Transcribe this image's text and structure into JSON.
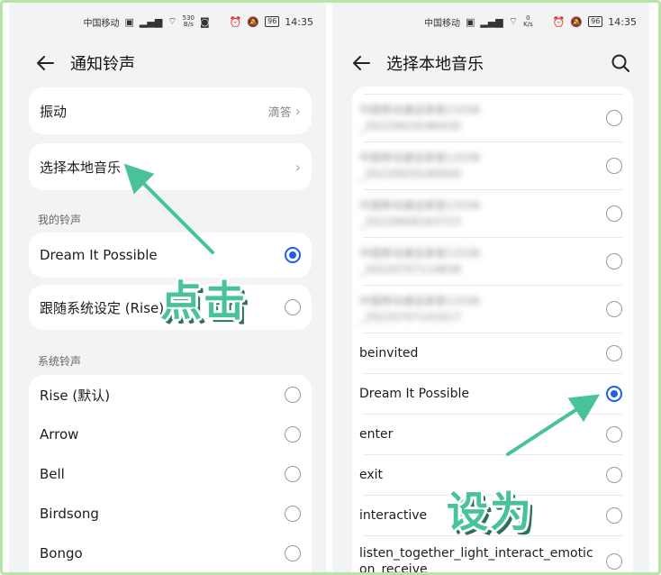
{
  "status_bar": {
    "carrier": "中国移动",
    "speed_left": "530\nB/s",
    "speed_right": "0\nK/s",
    "battery": "96",
    "time": "14:35"
  },
  "left": {
    "title": "通知铃声",
    "vibration": {
      "label": "振动",
      "value": "滴答"
    },
    "local_music": {
      "label": "选择本地音乐"
    },
    "my_ringtones_title": "我的铃声",
    "my_ringtones": [
      {
        "label": "Dream It Possible",
        "checked": true
      },
      {
        "label": "跟随系统设定 (Rise)",
        "checked": false
      }
    ],
    "system_ringtones_title": "系统铃声",
    "system_ringtones": [
      {
        "label": "Rise (默认)",
        "checked": false
      },
      {
        "label": "Arrow",
        "checked": false
      },
      {
        "label": "Bell",
        "checked": false
      },
      {
        "label": "Birdsong",
        "checked": false
      },
      {
        "label": "Bongo",
        "checked": false
      }
    ]
  },
  "right": {
    "title": "选择本地音乐",
    "blurred_items": [
      {
        "line1": "中国移动通话录音13336",
        "line2": "_20220929180430"
      },
      {
        "line1": "中国移动通话录音13336",
        "line2": "_20220929180600"
      },
      {
        "line1": "中国移动通话录音13336",
        "line2": "_20220606163723"
      },
      {
        "line1": "中国移动通话录音13336",
        "line2": "_20220707114838"
      },
      {
        "line1": "中国移动通话录音13336",
        "line2": "_20220707141617"
      }
    ],
    "items": [
      {
        "label": "beinvited",
        "checked": false
      },
      {
        "label": "Dream It Possible",
        "checked": true
      },
      {
        "label": "enter",
        "checked": false
      },
      {
        "label": "exit",
        "checked": false
      },
      {
        "label": "interactive",
        "checked": false
      }
    ],
    "long_item": "listen_together_light_interact_emoticon_receive"
  },
  "annotations": {
    "tap_label": "点击",
    "set_label": "设为",
    "arrow_color": "#48c29a"
  }
}
